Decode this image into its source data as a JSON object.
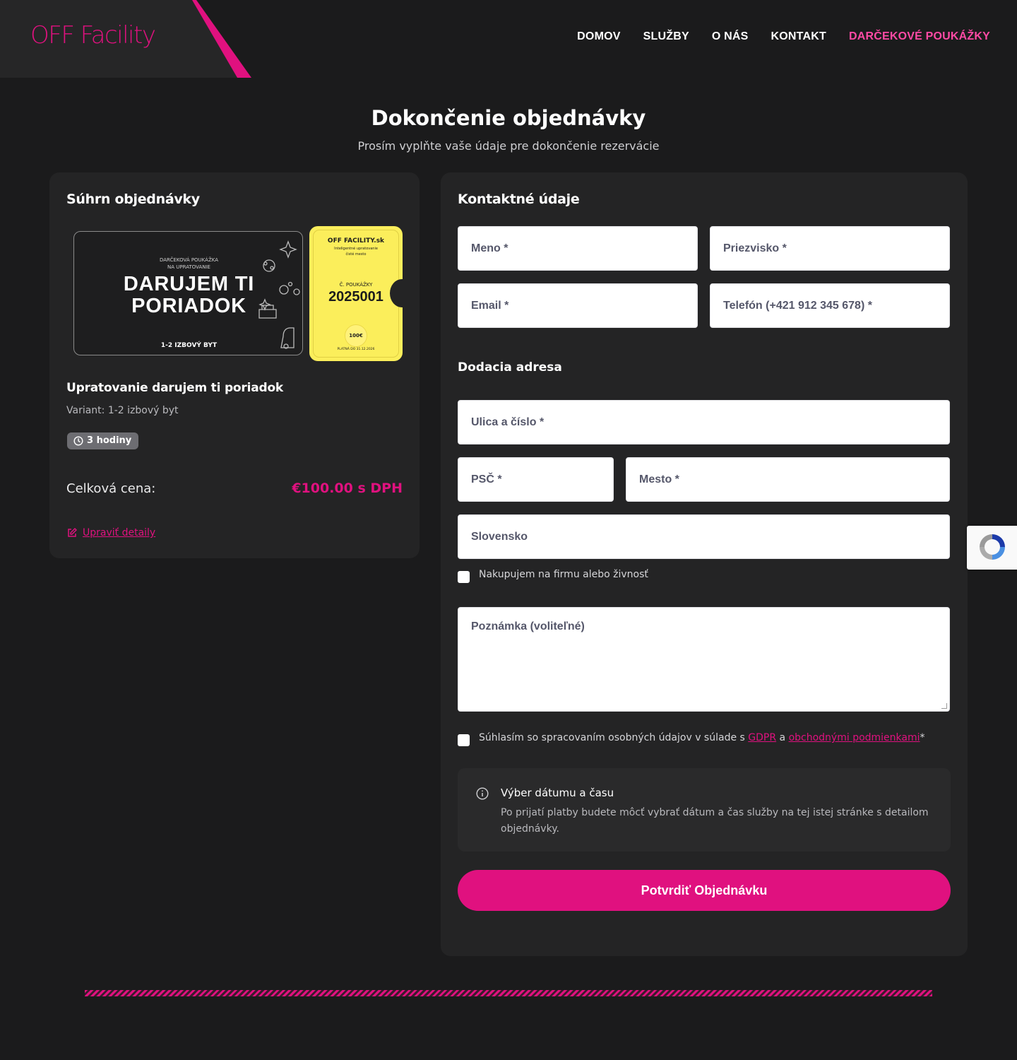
{
  "header": {
    "logo": "OFF Facility",
    "nav": [
      "DOMOV",
      "SLUŽBY",
      "O NÁS",
      "KONTAKT",
      "DARČEKOVÉ POUKÁŽKY"
    ]
  },
  "page": {
    "title": "Dokončenie objednávky",
    "subtitle": "Prosím vyplňte vaše údaje pre dokončenie rezervácie"
  },
  "summary": {
    "heading": "Súhrn objednávky",
    "voucher": {
      "line1": "DARČEKOVÁ POUKÁŽKA",
      "line2": "NA UPRATOVANIE",
      "big1": "DARUJEM TI",
      "big2": "PORIADOK",
      "footer": "1-2 IZBOVÝ BYT",
      "brand": "OFF FACILITY.sk",
      "tagline1": "Inteligentné upratovanie",
      "tagline2": "čisté mesto",
      "number_label": "Č. POUKÁŽKY",
      "number": "2025001",
      "value": "100€",
      "valid": "PLATNÁ DO 31.12.2026"
    },
    "product_name": "Upratovanie darujem ti poriadok",
    "variant": "Variant: 1-2 izbový byt",
    "duration_badge": "3 hodiny",
    "total_label": "Celková cena:",
    "total_price": "€100.00 s DPH",
    "edit_link": "Upraviť detaily"
  },
  "form": {
    "heading": "Kontaktné údaje",
    "first_name": "Meno *",
    "last_name": "Priezvisko *",
    "email": "Email *",
    "phone": "Telefón (+421 912 345 678) *",
    "address_heading": "Dodacia adresa",
    "street": "Ulica a číslo *",
    "zip": "PSČ *",
    "city": "Mesto *",
    "country": "Slovensko",
    "company_check": "Nakupujem na firmu alebo živnosť",
    "note": "Poznámka (voliteľné)",
    "consent_prefix": "Súhlasím so spracovaním osobných údajov v súlade s",
    "consent_gdpr": "GDPR",
    "consent_and": "a",
    "consent_terms": "obchodnými podmienkami",
    "consent_suffix": "*",
    "info_title": "Výber dátumu a času",
    "info_body": "Po prijatí platby budete môcť vybrať dátum a čas služby na tej istej stránke s detailom objednávky.",
    "submit": "Potvrdiť Objednávku"
  },
  "colors": {
    "accent": "#e0117f",
    "nav_accent": "#ff4aa5",
    "background": "#1b1b1c",
    "card": "#242425",
    "voucher_yellow": "#fbee5b"
  },
  "icons": [
    "clock-icon",
    "edit-icon",
    "info-icon",
    "recaptcha-icon"
  ]
}
